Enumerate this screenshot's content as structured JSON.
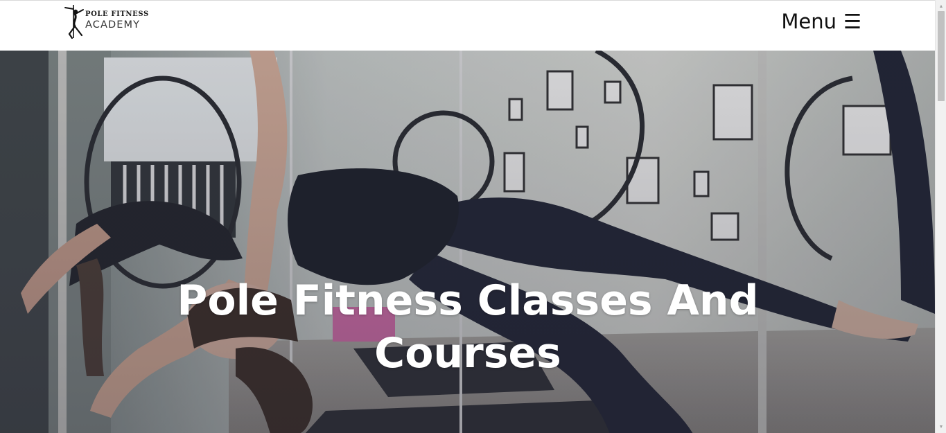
{
  "header": {
    "logo_line1": "POLE FITNESS",
    "logo_line2": "ACADEMY",
    "menu_label": "Menu",
    "menu_icon": "☰"
  },
  "hero": {
    "title": "Pole Fitness Classes And Courses",
    "image_icon": "aerial-hoop-photo"
  },
  "scrollbar": {
    "up_arrow": "▲",
    "down_arrow": "▼"
  },
  "colors": {
    "header_bg": "#ffffff",
    "title_color": "#ffffff",
    "text_dark": "#111111"
  }
}
